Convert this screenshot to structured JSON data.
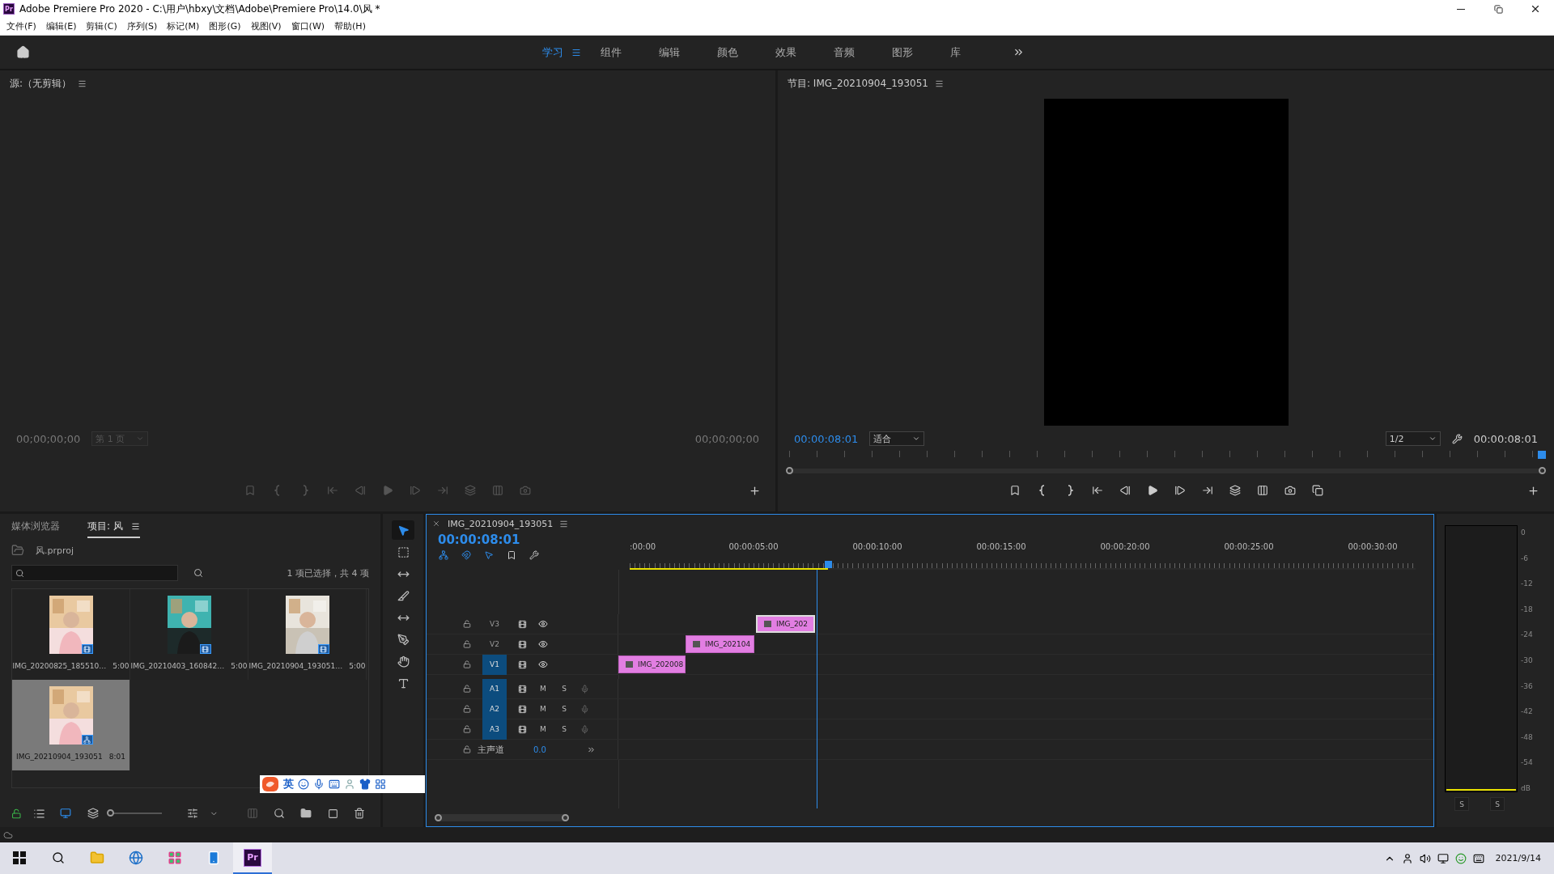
{
  "window": {
    "logo": "Pr",
    "title": "Adobe Premiere Pro 2020 - C:\\用户\\hbxy\\文档\\Adobe\\Premiere Pro\\14.0\\风 *"
  },
  "menu": [
    "文件(F)",
    "编辑(E)",
    "剪辑(C)",
    "序列(S)",
    "标记(M)",
    "图形(G)",
    "视图(V)",
    "窗口(W)",
    "帮助(H)"
  ],
  "workspaces": [
    {
      "label": "学习",
      "selected": true
    },
    {
      "label": "组件",
      "selected": false
    },
    {
      "label": "编辑",
      "selected": false
    },
    {
      "label": "颜色",
      "selected": false
    },
    {
      "label": "效果",
      "selected": false
    },
    {
      "label": "音频",
      "selected": false
    },
    {
      "label": "图形",
      "selected": false
    },
    {
      "label": "库",
      "selected": false
    }
  ],
  "source": {
    "title": "源:（无剪辑）",
    "timecode_in": "00;00;00;00",
    "page": "第 1 页",
    "timecode_out": "00;00;00;00",
    "disabled": true
  },
  "program": {
    "title": "节目: IMG_20210904_193051",
    "timecode": "00:00:08:01",
    "zoom": "适合",
    "resolution": "1/2",
    "duration": "00:00:08:01",
    "disabled": false
  },
  "project": {
    "tabs": [
      {
        "label": "媒体浏览器",
        "selected": false
      },
      {
        "label": "项目: 风",
        "selected": true
      }
    ],
    "file": "风.prproj",
    "status": "1 项已选择，共 4 项",
    "items": [
      {
        "name": "IMG_20200825_185510…",
        "duration": "5:00",
        "kind": "clip",
        "selected": false
      },
      {
        "name": "IMG_20210403_160842…",
        "duration": "5:00",
        "kind": "clip",
        "selected": false
      },
      {
        "name": "IMG_20210904_193051…",
        "duration": "5:00",
        "kind": "clip",
        "selected": false
      },
      {
        "name": "IMG_20210904_193051",
        "duration": "8:01",
        "kind": "sequence",
        "selected": true
      }
    ]
  },
  "thumbnail_zoom": {
    "level": 0
  },
  "tools": [
    {
      "kind": "select",
      "selected": true
    },
    {
      "kind": "track-select",
      "selected": false
    },
    {
      "kind": "ripple",
      "selected": false
    },
    {
      "kind": "razor",
      "selected": false
    },
    {
      "kind": "slip",
      "selected": false
    },
    {
      "kind": "pen",
      "selected": false
    },
    {
      "kind": "hand",
      "selected": false
    },
    {
      "kind": "type",
      "selected": false
    }
  ],
  "timeline": {
    "title": "IMG_20210904_193051",
    "timecode": "00:00:08:01",
    "ruler": [
      ":00:00",
      "00:00:05:00",
      "00:00:10:00",
      "00:00:15:00",
      "00:00:20:00",
      "00:00:25:00",
      "00:00:30:00"
    ],
    "video_tracks": [
      {
        "name": "V3",
        "targeted": false,
        "clip": {
          "label": "IMG_202",
          "selected": true
        }
      },
      {
        "name": "V2",
        "targeted": false,
        "clip": {
          "label": "IMG_202104",
          "selected": false
        }
      },
      {
        "name": "V1",
        "targeted": true,
        "clip": {
          "label": "IMG_202008",
          "selected": false
        }
      }
    ],
    "audio_tracks": [
      {
        "name": "A1",
        "targeted": true,
        "mute": "M",
        "solo": "S"
      },
      {
        "name": "A2",
        "targeted": true,
        "mute": "M",
        "solo": "S"
      },
      {
        "name": "A3",
        "targeted": true,
        "mute": "M",
        "solo": "S"
      }
    ],
    "master": {
      "label": "主声道",
      "value": "0.0"
    }
  },
  "meter": {
    "scale": [
      "0",
      "-6",
      "-12",
      "-18",
      "-24",
      "-30",
      "-36",
      "-42",
      "-48",
      "-54",
      "dB"
    ],
    "solo_buttons": [
      "S",
      "S"
    ]
  },
  "ime": {
    "mode": "英"
  },
  "taskbar": {
    "app_logo": "Pr",
    "date": "2021/9/14"
  }
}
